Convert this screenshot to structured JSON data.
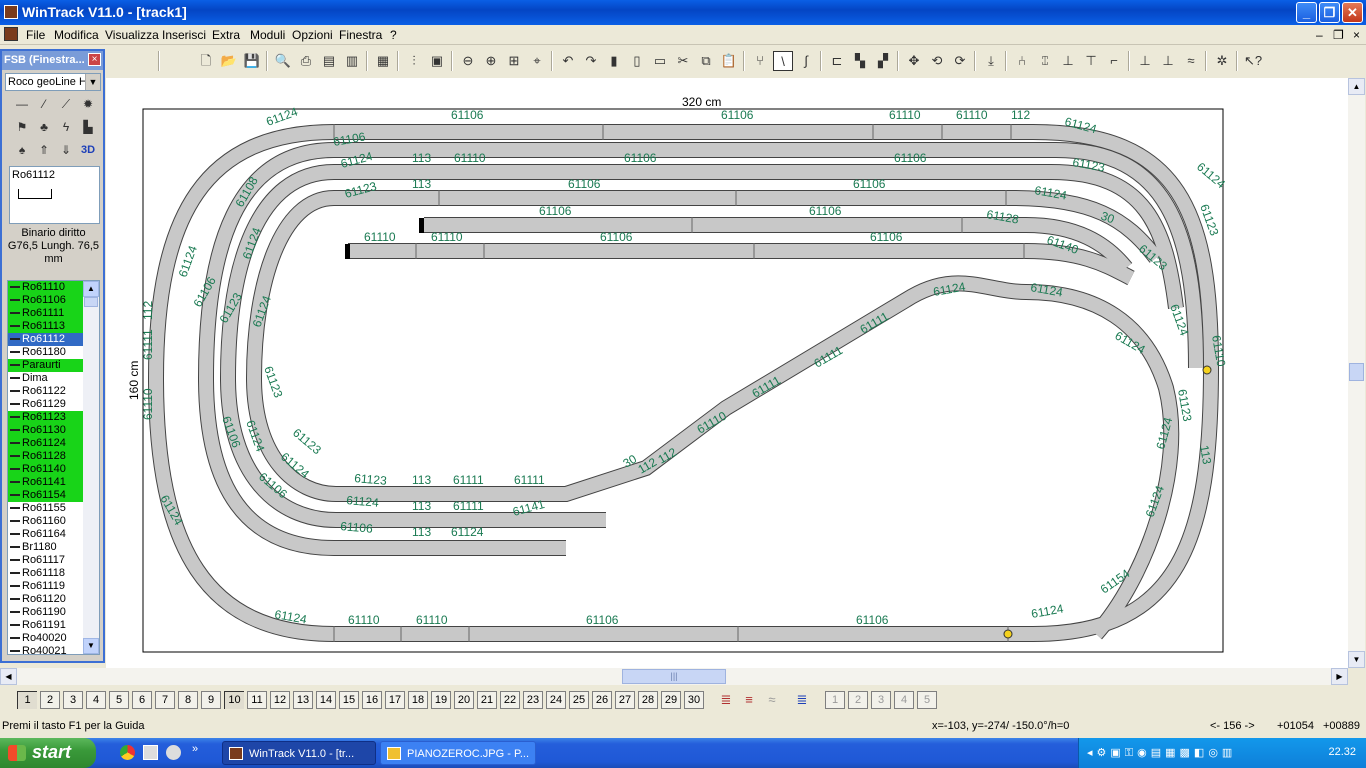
{
  "window": {
    "title": "WinTrack  V11.0 - [track1]",
    "min": "_",
    "max": "❐",
    "close": "✕"
  },
  "menu": [
    "File",
    "Modifica",
    "Visualizza",
    "Inserisci",
    "Extra",
    "Moduli",
    "Opzioni",
    "Finestra",
    "?"
  ],
  "mdi_controls": {
    "min": "–",
    "restore": "❐",
    "close": "×"
  },
  "panel": {
    "title": "FSB (Finestra...",
    "close": "×",
    "select_value": "Roco geoLine H",
    "icon_3d": "3D",
    "preview_label": "Ro61112",
    "description": "Binario diritto G76,5 Lungh. 76,5 mm",
    "items": [
      {
        "label": "Ro61110",
        "state": "green"
      },
      {
        "label": "Ro61106",
        "state": "green"
      },
      {
        "label": "Ro61111",
        "state": "green"
      },
      {
        "label": "Ro61113",
        "state": "green"
      },
      {
        "label": "Ro61112",
        "state": "selected"
      },
      {
        "label": "Ro61180",
        "state": "normal"
      },
      {
        "label": "Paraurti",
        "state": "green"
      },
      {
        "label": "Dima",
        "state": "normal"
      },
      {
        "label": "Ro61122",
        "state": "normal"
      },
      {
        "label": "Ro61129",
        "state": "normal"
      },
      {
        "label": "Ro61123",
        "state": "green"
      },
      {
        "label": "Ro61130",
        "state": "green"
      },
      {
        "label": "Ro61124",
        "state": "green"
      },
      {
        "label": "Ro61128",
        "state": "green"
      },
      {
        "label": "Ro61140",
        "state": "green"
      },
      {
        "label": "Ro61141",
        "state": "green"
      },
      {
        "label": "Ro61154",
        "state": "green"
      },
      {
        "label": "Ro61155",
        "state": "normal"
      },
      {
        "label": "Ro61160",
        "state": "normal"
      },
      {
        "label": "Ro61164",
        "state": "normal"
      },
      {
        "label": "Br1180",
        "state": "normal"
      },
      {
        "label": "Ro61117",
        "state": "normal"
      },
      {
        "label": "Ro61118",
        "state": "normal"
      },
      {
        "label": "Ro61119",
        "state": "normal"
      },
      {
        "label": "Ro61120",
        "state": "normal"
      },
      {
        "label": "Ro61190",
        "state": "normal"
      },
      {
        "label": "Ro61191",
        "state": "normal"
      },
      {
        "label": "Ro40020",
        "state": "normal"
      },
      {
        "label": "Ro40021",
        "state": "normal"
      }
    ]
  },
  "canvas": {
    "width_label": "320 cm",
    "height_label": "160 cm",
    "labels": [
      {
        "t": "61124"
      },
      {
        "t": "61106"
      },
      {
        "t": "61106"
      },
      {
        "t": "61110"
      },
      {
        "t": "61110"
      },
      {
        "t": "112"
      },
      {
        "t": "61124"
      },
      {
        "t": "61106"
      },
      {
        "t": "113"
      },
      {
        "t": "61110"
      },
      {
        "t": "61106"
      },
      {
        "t": "61106"
      },
      {
        "t": "61123"
      },
      {
        "t": "61124"
      },
      {
        "t": "113"
      },
      {
        "t": "61106"
      },
      {
        "t": "61106"
      },
      {
        "t": "61124"
      },
      {
        "t": "61123"
      },
      {
        "t": "61106"
      },
      {
        "t": "61106"
      },
      {
        "t": "61128"
      },
      {
        "t": "30"
      },
      {
        "t": "61110"
      },
      {
        "t": "61110"
      },
      {
        "t": "61106"
      },
      {
        "t": "61106"
      },
      {
        "t": "61140"
      },
      {
        "t": "61124"
      },
      {
        "t": "61124"
      },
      {
        "t": "61124"
      },
      {
        "t": "61111"
      },
      {
        "t": "61111"
      },
      {
        "t": "61111"
      },
      {
        "t": "61110"
      },
      {
        "t": "112"
      },
      {
        "t": "112"
      },
      {
        "t": "30"
      },
      {
        "t": "61123"
      },
      {
        "t": "113"
      },
      {
        "t": "61111"
      },
      {
        "t": "61111"
      },
      {
        "t": "61124"
      },
      {
        "t": "113"
      },
      {
        "t": "61111"
      },
      {
        "t": "61141"
      },
      {
        "t": "61106"
      },
      {
        "t": "113"
      },
      {
        "t": "61124"
      },
      {
        "t": "61124"
      },
      {
        "t": "61110"
      },
      {
        "t": "61110"
      },
      {
        "t": "61106"
      },
      {
        "t": "61106"
      },
      {
        "t": "61124"
      },
      {
        "t": "61124"
      },
      {
        "t": "61124"
      },
      {
        "t": "61154"
      },
      {
        "t": "113"
      },
      {
        "t": "61110"
      },
      {
        "t": "112"
      },
      {
        "t": "61111"
      },
      {
        "t": "61110"
      },
      {
        "t": "61124"
      },
      {
        "t": "61106"
      },
      {
        "t": "61108"
      },
      {
        "t": "61124"
      },
      {
        "t": "61124"
      },
      {
        "t": "61123"
      },
      {
        "t": "61124"
      },
      {
        "t": "61123"
      },
      {
        "t": "61106"
      },
      {
        "t": "61124"
      },
      {
        "t": "61123"
      },
      {
        "t": "61124"
      },
      {
        "t": "61106"
      },
      {
        "t": "61124"
      },
      {
        "t": "61123"
      },
      {
        "t": "61123"
      },
      {
        "t": "61124"
      },
      {
        "t": "61123"
      }
    ]
  },
  "layers": [
    "1",
    "2",
    "3",
    "4",
    "5",
    "6",
    "7",
    "8",
    "9",
    "10",
    "11",
    "12",
    "13",
    "14",
    "15",
    "16",
    "17",
    "18",
    "19",
    "20",
    "21",
    "22",
    "23",
    "24",
    "25",
    "26",
    "27",
    "28",
    "29",
    "30"
  ],
  "status": {
    "help": "Premi il tasto F1 per la Guida",
    "coords": "x=-103, y=-274/ -150.0°/h=0",
    "nav": "<- 156 ->",
    "v1": "+01054",
    "v2": "+00889"
  },
  "taskbar": {
    "start": "start",
    "task1": "WinTrack  V11.0 - [tr...",
    "task2": "PIANOZEROC.JPG - P...",
    "clock": "22.32"
  }
}
